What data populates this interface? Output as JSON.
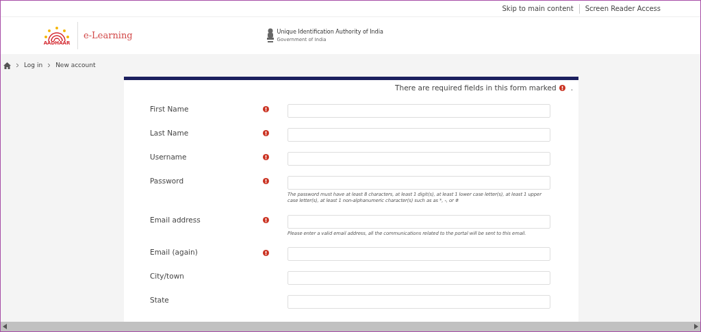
{
  "top_links": [
    "Skip to main content",
    "Screen Reader Access"
  ],
  "header": {
    "site_title": "e-Learning",
    "org_name": "Unique Identification Authority of India",
    "org_subtitle": "Government of India",
    "logo_text": "AADHAAR"
  },
  "breadcrumb": [
    "Log in",
    "New account"
  ],
  "form": {
    "required_notice": "There are required fields in this form marked",
    "notice_end": ".",
    "fields": [
      {
        "label": "First Name",
        "required": true
      },
      {
        "label": "Last Name",
        "required": true
      },
      {
        "label": "Username",
        "required": true
      },
      {
        "label": "Password",
        "required": true,
        "help": "The password must have at least 8 characters, at least 1 digit(s), at least 1 lower case letter(s), at least 1 upper case letter(s), at least 1 non-alphanumeric character(s) such as as *, -, or #"
      },
      {
        "label": "Email address",
        "required": true,
        "help": "Please enter a valid email address, all the communications related to the portal will be sent to this email."
      },
      {
        "label": "Email (again)",
        "required": true
      },
      {
        "label": "City/town",
        "required": false
      },
      {
        "label": "State",
        "required": false
      }
    ]
  }
}
